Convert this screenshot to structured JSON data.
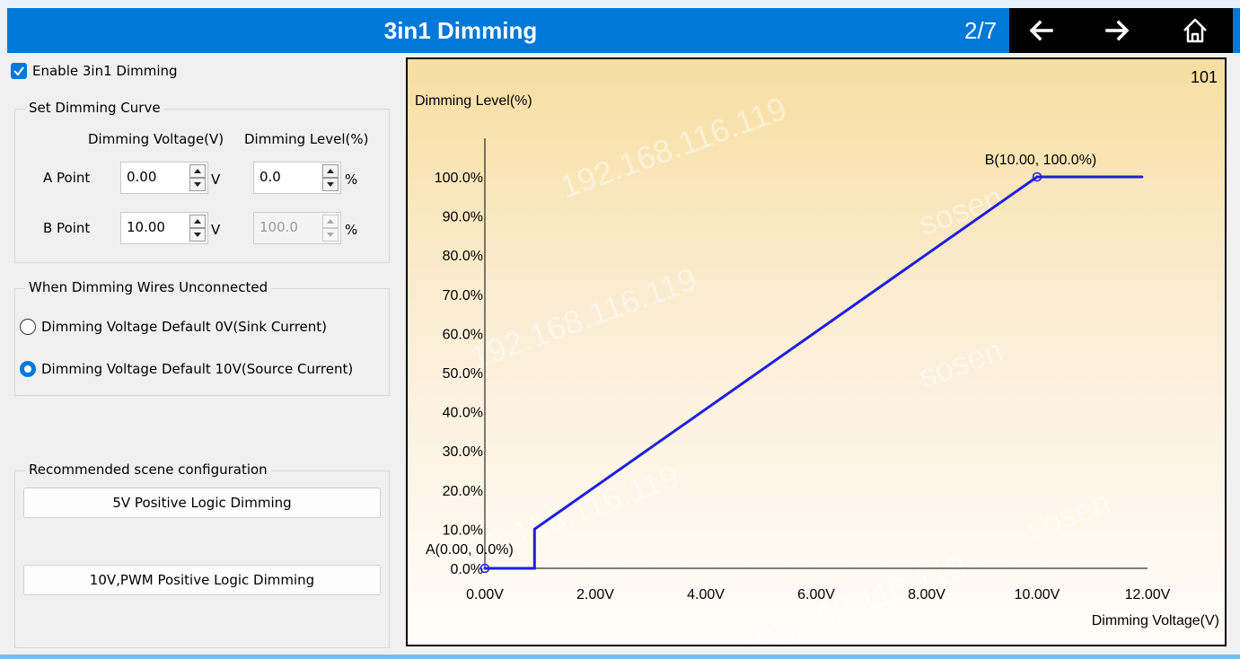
{
  "header": {
    "title": "3in1 Dimming",
    "page_indicator": "2/7",
    "prev_icon": "arrow-left-icon",
    "next_icon": "arrow-right-icon",
    "home_icon": "home-icon"
  },
  "enable": {
    "label": "Enable 3in1 Dimming",
    "checked": true
  },
  "curve": {
    "group_label": "Set Dimming Curve",
    "col_voltage": "Dimming Voltage(V)",
    "col_level": "Dimming Level(%)",
    "a": {
      "label": "A Point",
      "voltage": "0.00",
      "voltage_unit": "V",
      "level": "0.0",
      "level_unit": "%"
    },
    "b": {
      "label": "B Point",
      "voltage": "10.00",
      "voltage_unit": "V",
      "level": "100.0",
      "level_unit": "%"
    }
  },
  "unconnected": {
    "group_label": "When Dimming Wires Unconnected",
    "options": [
      {
        "label": "Dimming Voltage Default 0V(Sink Current)",
        "selected": false
      },
      {
        "label": "Dimming Voltage Default 10V(Source Current)",
        "selected": true
      }
    ]
  },
  "recommended": {
    "group_label": "Recommended scene configuration",
    "buttons": [
      "5V Positive Logic Dimming",
      "10V,PWM Positive Logic Dimming"
    ]
  },
  "chart_data": {
    "type": "line",
    "corner_text": "101",
    "ylabel": "Dimming Level(%)",
    "xlabel": "Dimming Voltage(V)",
    "xlim": [
      0,
      12
    ],
    "ylim": [
      0,
      100
    ],
    "x_ticks": [
      "0.00V",
      "2.00V",
      "4.00V",
      "6.00V",
      "8.00V",
      "10.00V",
      "12.00V"
    ],
    "y_ticks": [
      "0.0%",
      "10.0%",
      "20.0%",
      "30.0%",
      "40.0%",
      "50.0%",
      "60.0%",
      "70.0%",
      "80.0%",
      "90.0%",
      "100.0%"
    ],
    "series": [
      {
        "points": [
          [
            0,
            0
          ],
          [
            0.9,
            0
          ],
          [
            0.9,
            10
          ],
          [
            10,
            100
          ],
          [
            11.9,
            100
          ]
        ]
      }
    ],
    "annotations": [
      {
        "label": "A(0.00, 0.0%)",
        "x": 0,
        "y": 0
      },
      {
        "label": "B(10.00, 100.0%)",
        "x": 10,
        "y": 100
      }
    ],
    "line_color": "#1f1fe0",
    "watermark": [
      "192.168.116.119",
      "sosen"
    ]
  },
  "colors": {
    "accent": "#0078d7",
    "nav_bg": "#000000",
    "line": "#1f1fe0"
  }
}
